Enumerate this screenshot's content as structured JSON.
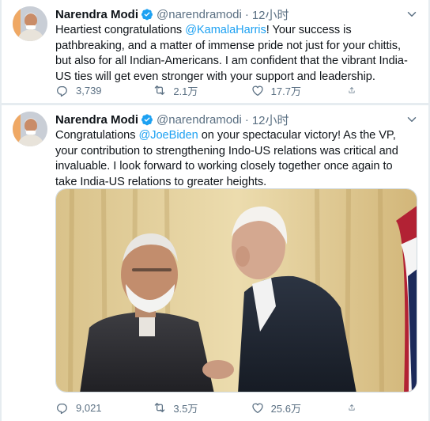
{
  "tweets": [
    {
      "author": "Narendra Modi",
      "handle": "@narendramodi",
      "separator": "·",
      "time": "12小时",
      "text_parts": {
        "p1": "Heartiest congratulations ",
        "mention": "@KamalaHarris",
        "p2": "! Your success is pathbreaking, and a matter of immense pride not just for your chittis, but also for all Indian-Americans. I am confident that the vibrant India-US ties will get even stronger with your support and leadership."
      },
      "replies": "3,739",
      "retweets": "2.1万",
      "likes": "17.7万"
    },
    {
      "author": "Narendra Modi",
      "handle": "@narendramodi",
      "separator": "·",
      "time": "12小时",
      "text_parts": {
        "p1": "Congratulations ",
        "mention": "@JoeBiden",
        "p2": " on your spectacular victory! As the VP, your contribution to strengthening Indo-US relations was critical and invaluable. I look forward to working closely together once again to take India-US relations to greater heights."
      },
      "replies": "9,021",
      "retweets": "3.5万",
      "likes": "25.6万"
    }
  ],
  "icons": {
    "verified": "verified-badge-icon",
    "more": "chevron-down-icon",
    "reply": "reply-icon",
    "retweet": "retweet-icon",
    "like": "heart-icon",
    "share": "share-icon"
  },
  "colors": {
    "accent": "#1da1f2",
    "muted": "#5b7083",
    "background": "#e6ecf0"
  }
}
